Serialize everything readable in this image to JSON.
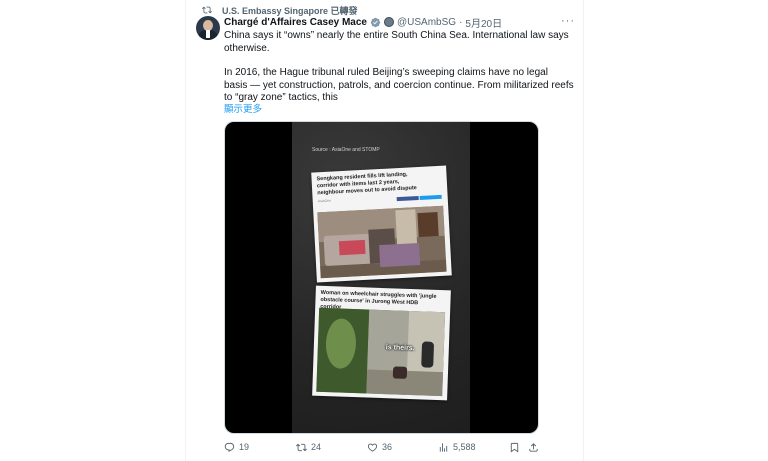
{
  "repost": {
    "text": "U.S. Embassy Singapore 已轉發"
  },
  "author": {
    "name": "Chargé d'Affaires Casey Mace",
    "handle": "@USAmbSG",
    "separator": "·",
    "date": "5月20日"
  },
  "tweet": {
    "paragraph1": "China says it “owns” nearly the entire South China Sea. International law says otherwise.",
    "paragraph2": "In 2016, the Hague tribunal ruled Beijing’s sweeping claims have no legal basis — yet construction, patrols, and coercion continue. From militarized reefs to “gray zone” tactics, this",
    "show_more": "顯示更多"
  },
  "media": {
    "source": "Source : AsiaOne and STOMP",
    "card1_headline": "Sengkang resident fills lift landing, corridor with items last 2 years, neighbour moves out to avoid dispute",
    "card1_meta": "AsiaOne",
    "card2_headline": "Woman on wheelchair struggles with 'jungle obstacle course' in Jurong West HDB corridor",
    "caption": "is theirs."
  },
  "actions": {
    "replies": "19",
    "reposts": "24",
    "likes": "36",
    "views": "5,588"
  },
  "colors": {
    "accent": "#1d9bf0",
    "muted": "#536471",
    "text": "#0f1419",
    "verified": "#1d9bf0"
  },
  "icons": {
    "repost_header": "retweet-icon",
    "verified": "verified-badge-icon",
    "government": "government-badge-icon",
    "more": "more-dots-icon",
    "reply": "reply-icon",
    "repost": "retweet-icon",
    "like": "heart-icon",
    "views": "views-chart-icon",
    "bookmark": "bookmark-icon",
    "share": "share-icon"
  }
}
